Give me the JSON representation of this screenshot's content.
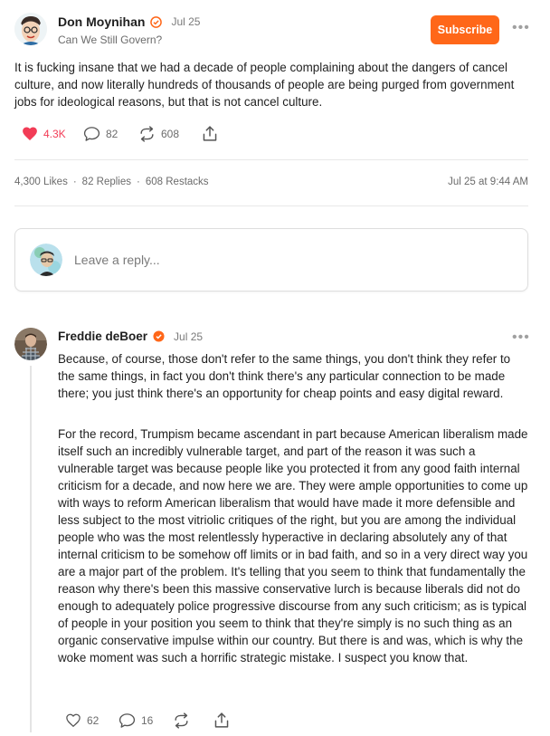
{
  "colors": {
    "accent": "#ff6719",
    "like": "#f23c56",
    "verified": "#ff6719"
  },
  "post": {
    "author": "Don Moynihan",
    "date": "Jul 25",
    "publication": "Can We Still Govern?",
    "subscribe_label": "Subscribe",
    "text": "It is fucking insane that we had a decade of people complaining about the dangers of cancel culture, and now literally hundreds of thousands of people are being purged from government jobs for ideological reasons, but that is not cancel culture.",
    "likes": "4.3K",
    "replies": "82",
    "restacks": "608",
    "stats": {
      "likes": "4,300 Likes",
      "replies": "82 Replies",
      "restacks": "608 Restacks",
      "timestamp": "Jul 25 at 9:44 AM"
    }
  },
  "reply_box": {
    "placeholder": "Leave a reply..."
  },
  "comment": {
    "author": "Freddie deBoer",
    "date": "Jul 25",
    "paragraph1": "Because, of course, those don't refer to the same things, you don't think they refer to the same things, in fact you don't think there's any particular connection to be made there; you just think there's an opportunity for cheap points and easy digital reward.",
    "paragraph2": "For the record, Trumpism became ascendant in part because American liberalism made itself such an incredibly vulnerable target, and part of the reason it was such a vulnerable target was because people like you protected it from any good faith internal criticism for a decade, and now here we are. They were ample opportunities to come up with ways to reform American liberalism that would have made it more defensible and less subject to the most vitriolic critiques of the right, but you are among the individual people who was the most relentlessly hyperactive in declaring absolutely any of that internal criticism to be somehow off limits or in bad faith, and so in a very direct way you are a major part of the problem. It's telling that you seem to think that fundamentally the reason why there's been this massive conservative lurch is because liberals did not do enough to adequately police progressive discourse from any such criticism; as is typical of people in your position you seem to think that they're simply is no such thing as an organic conservative impulse within our country. But there is and was, which is why the woke moment was such a horrific strategic mistake. I suspect you know that.",
    "likes": "62",
    "replies": "16"
  }
}
